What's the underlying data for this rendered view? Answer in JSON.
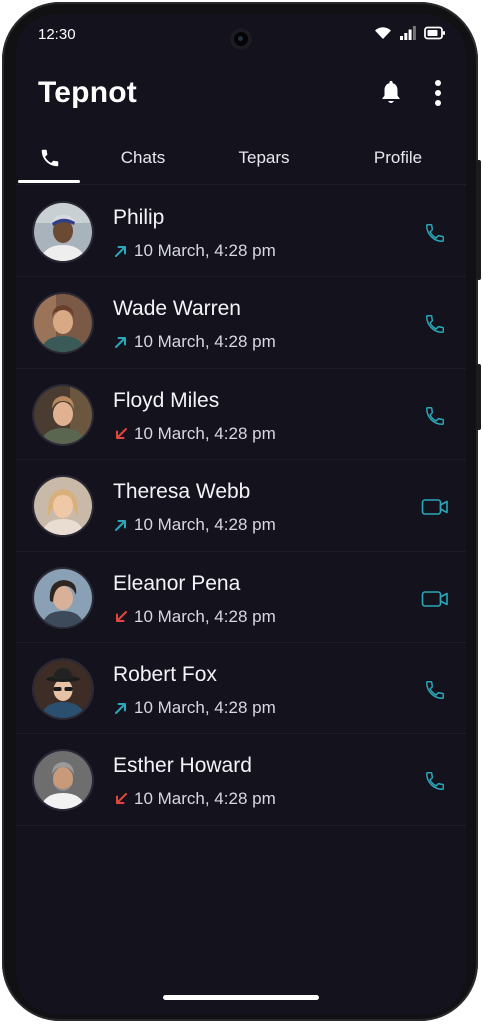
{
  "status_bar": {
    "time": "12:30"
  },
  "app_bar": {
    "title": "Tepnot",
    "icons": [
      "bell-icon",
      "more-vertical-icon"
    ]
  },
  "tabs": [
    {
      "label": "",
      "icon": "phone-icon",
      "active": true
    },
    {
      "label": "Chats",
      "active": false
    },
    {
      "label": "Tepars",
      "active": false
    },
    {
      "label": "Profile",
      "active": false
    }
  ],
  "colors": {
    "background": "#13121d",
    "accent": "#2aa7b8",
    "missed": "#e2463c",
    "text": "#ffffff"
  },
  "calls": [
    {
      "name": "Philip",
      "direction": "outgoing",
      "time": "10 March, 4:28 pm",
      "type": "voice"
    },
    {
      "name": "Wade Warren",
      "direction": "outgoing",
      "time": "10 March, 4:28 pm",
      "type": "voice"
    },
    {
      "name": "Floyd Miles",
      "direction": "incoming-missed",
      "time": "10 March, 4:28 pm",
      "type": "voice"
    },
    {
      "name": "Theresa Webb",
      "direction": "outgoing",
      "time": "10 March, 4:28 pm",
      "type": "video"
    },
    {
      "name": "Eleanor Pena",
      "direction": "incoming-missed",
      "time": "10 March, 4:28 pm",
      "type": "video"
    },
    {
      "name": "Robert Fox",
      "direction": "outgoing",
      "time": "10 March, 4:28 pm",
      "type": "voice"
    },
    {
      "name": "Esther Howard",
      "direction": "incoming-missed",
      "time": "10 March, 4:28 pm",
      "type": "voice"
    }
  ]
}
